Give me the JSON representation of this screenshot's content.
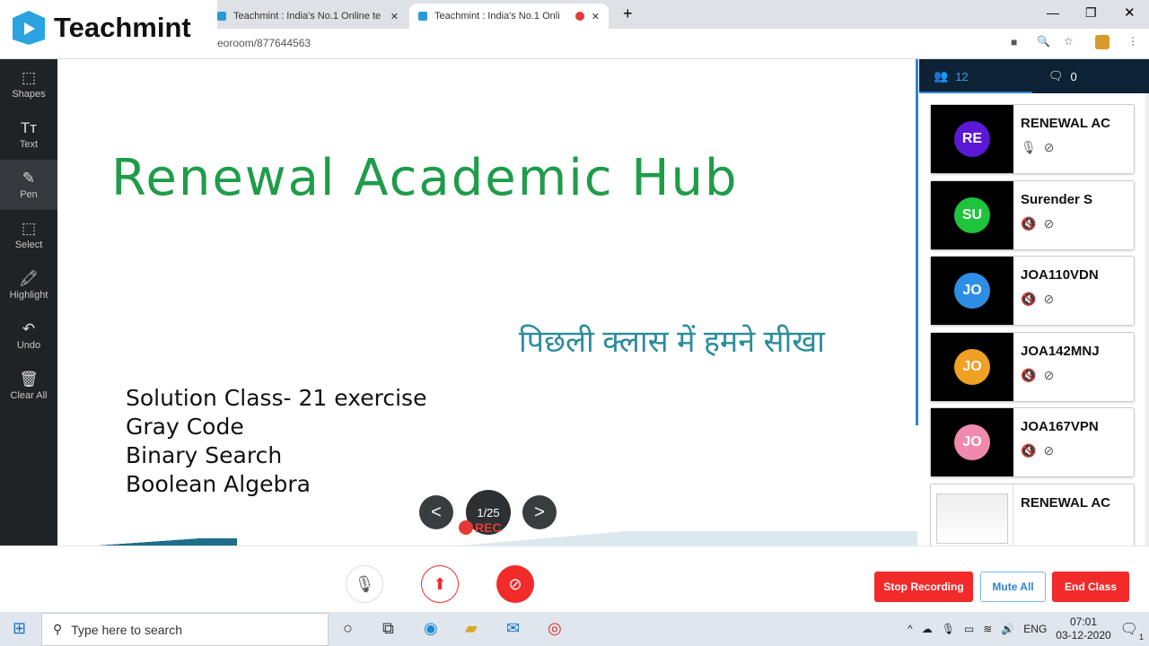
{
  "browser": {
    "tabs": [
      {
        "title": "Teachmint : India's No.1 Online te",
        "active": false
      },
      {
        "title": "Teachmint : India's No.1 Onli",
        "active": true,
        "recording": true
      }
    ],
    "new_tab": "+",
    "url": "eoroom/877644563",
    "window_controls": [
      "minimize",
      "restore",
      "close"
    ]
  },
  "logo": {
    "text": "Teachmint"
  },
  "tools": [
    {
      "label": "Shapes",
      "icon": "shapes-icon",
      "glyph": "⬚"
    },
    {
      "label": "Text",
      "icon": "text-icon",
      "glyph": "Tт"
    },
    {
      "label": "Pen",
      "icon": "pen-icon",
      "glyph": "✎",
      "active": true
    },
    {
      "label": "Select",
      "icon": "select-icon",
      "glyph": "⬚"
    },
    {
      "label": "Highlight",
      "icon": "highlight-icon",
      "glyph": "🖍"
    },
    {
      "label": "Undo",
      "icon": "undo-icon",
      "glyph": "↶"
    },
    {
      "label": "Clear All",
      "icon": "trash-icon",
      "glyph": "🗑"
    }
  ],
  "slide": {
    "title": "Renewal Academic Hub",
    "hindi": "पिछली क्लास में हमने सीखा",
    "bullets": [
      "Solution Class- 21 exercise",
      "Gray Code",
      "Binary Search",
      "Boolean Algebra"
    ],
    "prev": "<",
    "next": ">",
    "page": "1/25",
    "rec": "REC"
  },
  "panel": {
    "participants_count": "12",
    "chat_count": "0",
    "participants": [
      {
        "initials": "RE",
        "name": "RENEWAL AC",
        "color": "#5b18d6",
        "mic": "on",
        "video": "off"
      },
      {
        "initials": "SU",
        "name": "Surender S",
        "color": "#1ec43c",
        "mic": "off",
        "video": "off"
      },
      {
        "initials": "JO",
        "name": "JOA110VDN",
        "color": "#2e8ee6",
        "mic": "off",
        "video": "off"
      },
      {
        "initials": "JO",
        "name": "JOA142MNJ",
        "color": "#f0a023",
        "mic": "off",
        "video": "off"
      },
      {
        "initials": "JO",
        "name": "JOA167VPN",
        "color": "#ef8aae",
        "mic": "off",
        "video": "off"
      },
      {
        "initials": "",
        "name": "RENEWAL AC",
        "color": "#000000",
        "screen_share": true
      }
    ]
  },
  "controls": {
    "stop_recording": "Stop Recording",
    "mute_all": "Mute All",
    "end_class": "End Class"
  },
  "taskbar": {
    "search_placeholder": "Type here to search",
    "lang": "ENG",
    "time": "07:01",
    "date": "03-12-2020",
    "notifications": "1"
  },
  "colors": {
    "accent": "#2f80d6",
    "danger": "#f32a2a",
    "heading_green": "#1f9c4a"
  }
}
